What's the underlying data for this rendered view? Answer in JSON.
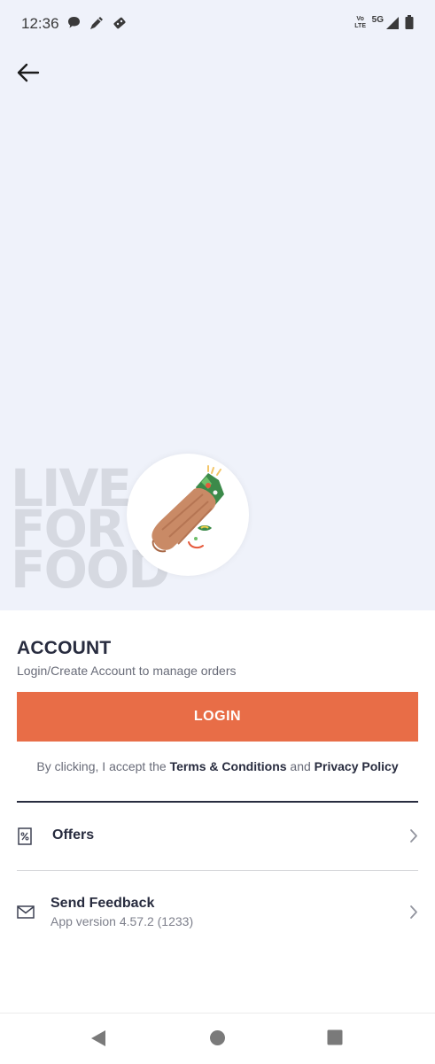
{
  "status_bar": {
    "time": "12:36",
    "network_label_top": "Vo",
    "network_label_bottom": "LTE",
    "signal_label": "5G"
  },
  "hero": {
    "tagline": [
      "LIVE",
      "FOR",
      "FOOD"
    ]
  },
  "account": {
    "title": "ACCOUNT",
    "subtitle": "Login/Create Account to manage orders",
    "login_label": "LOGIN",
    "terms_prefix": "By clicking, I accept the ",
    "terms_link": "Terms & Conditions",
    "terms_and": " and ",
    "privacy_link": "Privacy Policy"
  },
  "menu": {
    "offers_label": "Offers",
    "feedback_label": "Send Feedback",
    "app_version": "App version 4.57.2 (1233)"
  },
  "colors": {
    "accent": "#e86d47",
    "hero_bg": "#eff2fa",
    "text_dark": "#282c3f"
  }
}
